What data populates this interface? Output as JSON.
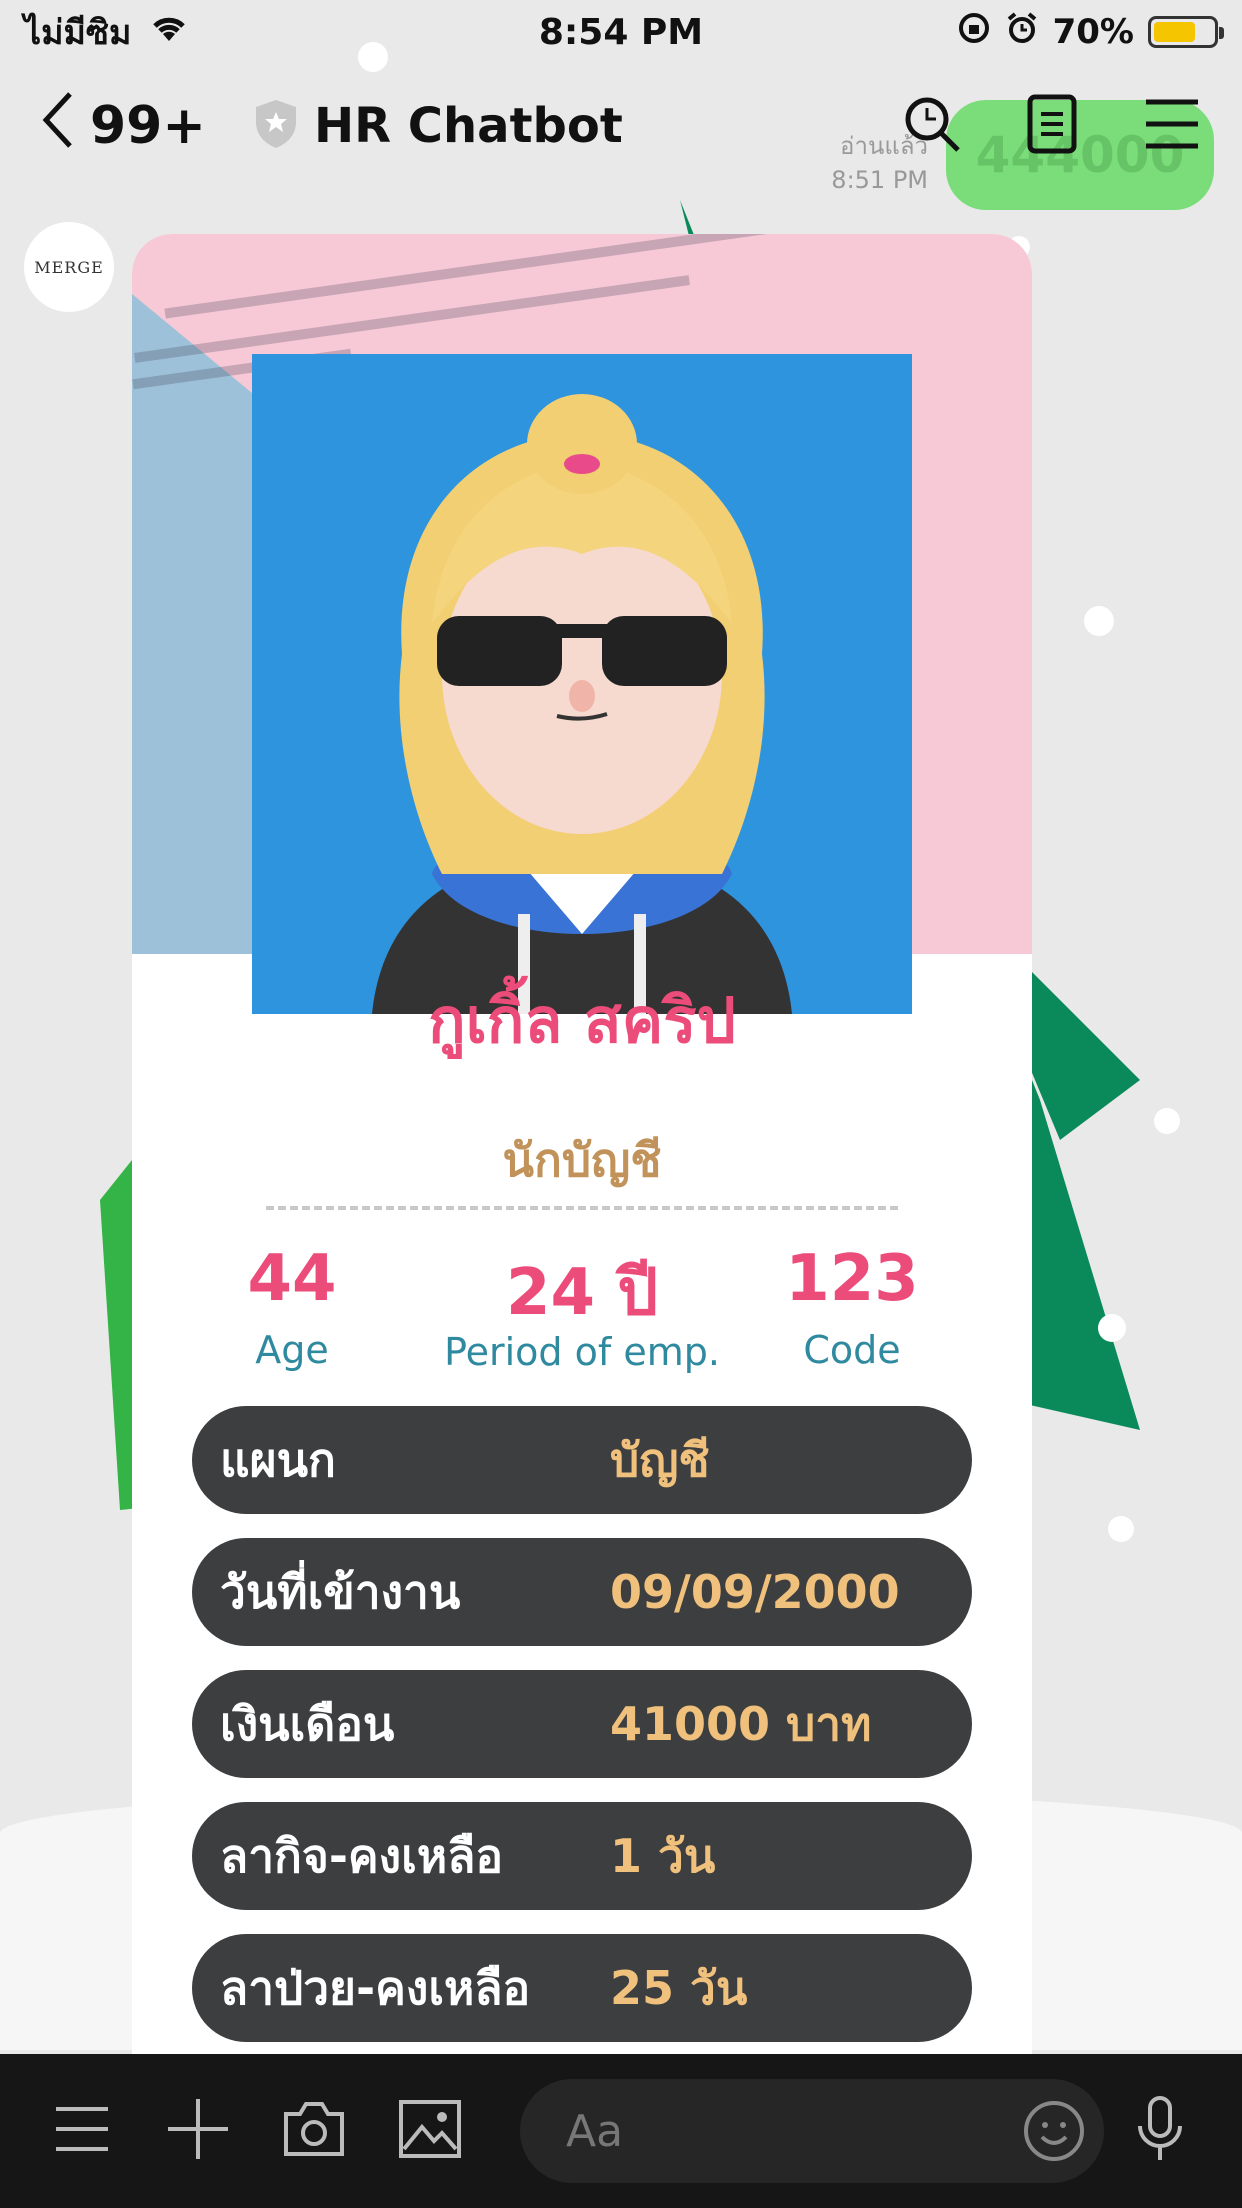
{
  "status_bar": {
    "carrier": "ไม่มีซิม",
    "time": "8:54 PM",
    "battery": "70%",
    "icons": [
      "wifi-icon",
      "orientation-lock-icon",
      "alarm-icon",
      "battery-icon"
    ]
  },
  "header": {
    "unread_count": "99+",
    "title": "HR Chatbot",
    "icons": [
      "back-icon",
      "shield-icon",
      "search-icon",
      "notes-icon",
      "menu-icon"
    ]
  },
  "background_message": {
    "read_label": "อ่านแล้ว",
    "time": "8:51 PM",
    "text": "444000"
  },
  "chat_avatar": {
    "label": "MERGE"
  },
  "profile_card": {
    "name": "กูเกิ้ล สคริป",
    "position": "นักบัญชี",
    "stats": [
      {
        "value": "44",
        "label": "Age"
      },
      {
        "value": "24 ปี",
        "label": "Period of emp."
      },
      {
        "value": "123",
        "label": "Code"
      }
    ],
    "rows": [
      {
        "label": "แผนก",
        "value": "บัญชี"
      },
      {
        "label": "วันที่เข้างาน",
        "value": "09/09/2000"
      },
      {
        "label": "เงินเดือน",
        "value": "41000 บาท"
      },
      {
        "label": "ลากิจ-คงเหลือ",
        "value": "1 วัน"
      },
      {
        "label": "ลาป่วย-คงเหลือ",
        "value": "25 วัน"
      }
    ]
  },
  "input_bar": {
    "placeholder": "Aa",
    "icons": [
      "menu-icon",
      "plus-icon",
      "camera-icon",
      "image-icon",
      "emoji-icon",
      "microphone-icon"
    ]
  },
  "colors": {
    "accent_pink": "#ec4c79",
    "stat_label_teal": "#2f8aa0",
    "position_gold": "#c1935a",
    "row_bg": "#3d3e40",
    "row_value": "#f0c07d",
    "photo_bg": "#2f94de",
    "banner_pink": "#f7c9d6"
  }
}
